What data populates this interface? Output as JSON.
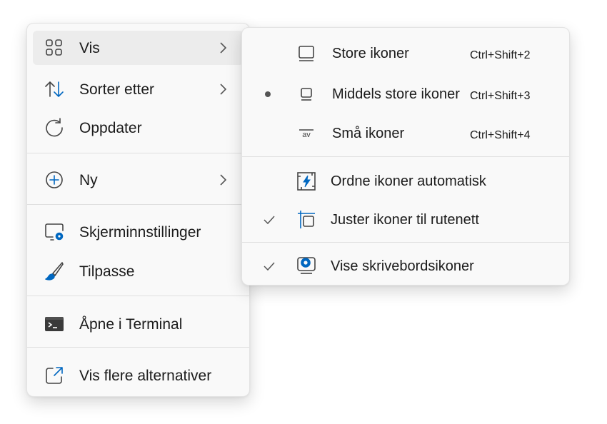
{
  "main_menu": {
    "items": [
      {
        "label": "Vis",
        "icon": "grid-icon",
        "has_submenu": true
      },
      {
        "label": "Sorter etter",
        "icon": "sort-icon",
        "has_submenu": true
      },
      {
        "label": "Oppdater",
        "icon": "refresh-icon",
        "has_submenu": false
      },
      {
        "label": "Ny",
        "icon": "add-circle-icon",
        "has_submenu": true
      },
      {
        "label": "Skjerminnstillinger",
        "icon": "display-settings-icon",
        "has_submenu": false
      },
      {
        "label": "Tilpasse",
        "icon": "brush-icon",
        "has_submenu": false
      },
      {
        "label": "Åpne i Terminal",
        "icon": "terminal-icon",
        "has_submenu": false
      },
      {
        "label": "Vis flere alternativer",
        "icon": "share-open-icon",
        "has_submenu": false
      }
    ]
  },
  "sub_menu": {
    "items": [
      {
        "label": "Store ikoner",
        "accelerator": "Ctrl+Shift+2",
        "icon": "large-icons-icon",
        "state": "none"
      },
      {
        "label": "Middels store ikoner",
        "accelerator": "Ctrl+Shift+3",
        "icon": "medium-icons-icon",
        "state": "selected"
      },
      {
        "label": "Små ikoner",
        "accelerator": "Ctrl+Shift+4",
        "icon": "small-icons-icon",
        "icon_text": "av",
        "state": "none"
      },
      {
        "label": "Ordne ikoner automatisk",
        "icon": "auto-arrange-icon",
        "state": "none"
      },
      {
        "label": "Juster ikoner til rutenett",
        "icon": "align-grid-icon",
        "state": "checked"
      },
      {
        "label": "Vise skrivebordsikoner",
        "icon": "show-desktop-icons-icon",
        "state": "checked"
      }
    ]
  },
  "colors": {
    "accent": "#0067c0",
    "menu_bg": "#f9f9f9",
    "hover_bg": "#ececec",
    "text": "#1b1b1b"
  }
}
